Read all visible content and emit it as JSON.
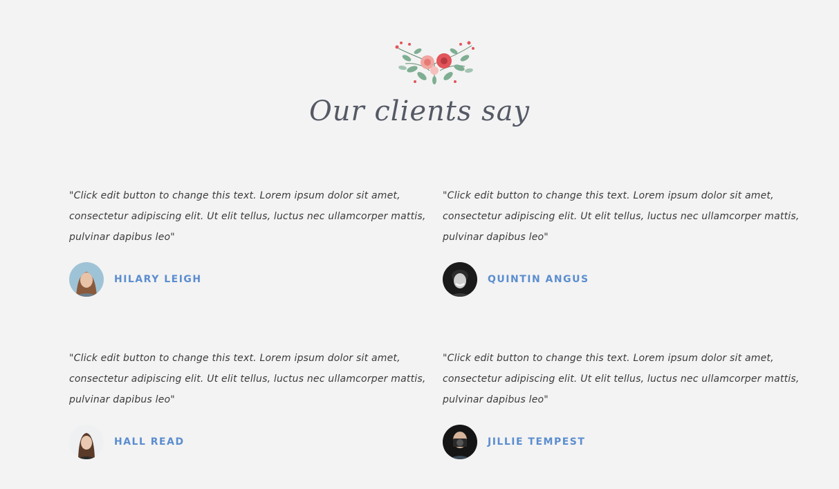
{
  "section": {
    "heading": "Our clients say"
  },
  "colors": {
    "background": "#f3f3f3",
    "heading": "#545965",
    "quote_text": "#3a3a3a",
    "author_name": "#5b8dcf"
  },
  "testimonials": [
    {
      "quote": "\"Click edit button to change this text. Lorem ipsum dolor sit amet, consectetur adipiscing elit. Ut elit tellus, luctus nec ullamcorper mattis, pulvinar dapibus leo\"",
      "name": "HILARY LEIGH"
    },
    {
      "quote": "\"Click edit button to change this text. Lorem ipsum dolor sit amet, consectetur adipiscing elit. Ut elit tellus, luctus nec ullamcorper mattis, pulvinar dapibus leo\"",
      "name": "QUINTIN ANGUS"
    },
    {
      "quote": "\"Click edit button to change this text. Lorem ipsum dolor sit amet, consectetur adipiscing elit. Ut elit tellus, luctus nec ullamcorper mattis, pulvinar dapibus leo\"",
      "name": "HALL READ"
    },
    {
      "quote": "\"Click edit button to change this text. Lorem ipsum dolor sit amet, consectetur adipiscing elit. Ut elit tellus, luctus nec ullamcorper mattis, pulvinar dapibus leo\"",
      "name": "JILLIE TEMPEST"
    }
  ]
}
